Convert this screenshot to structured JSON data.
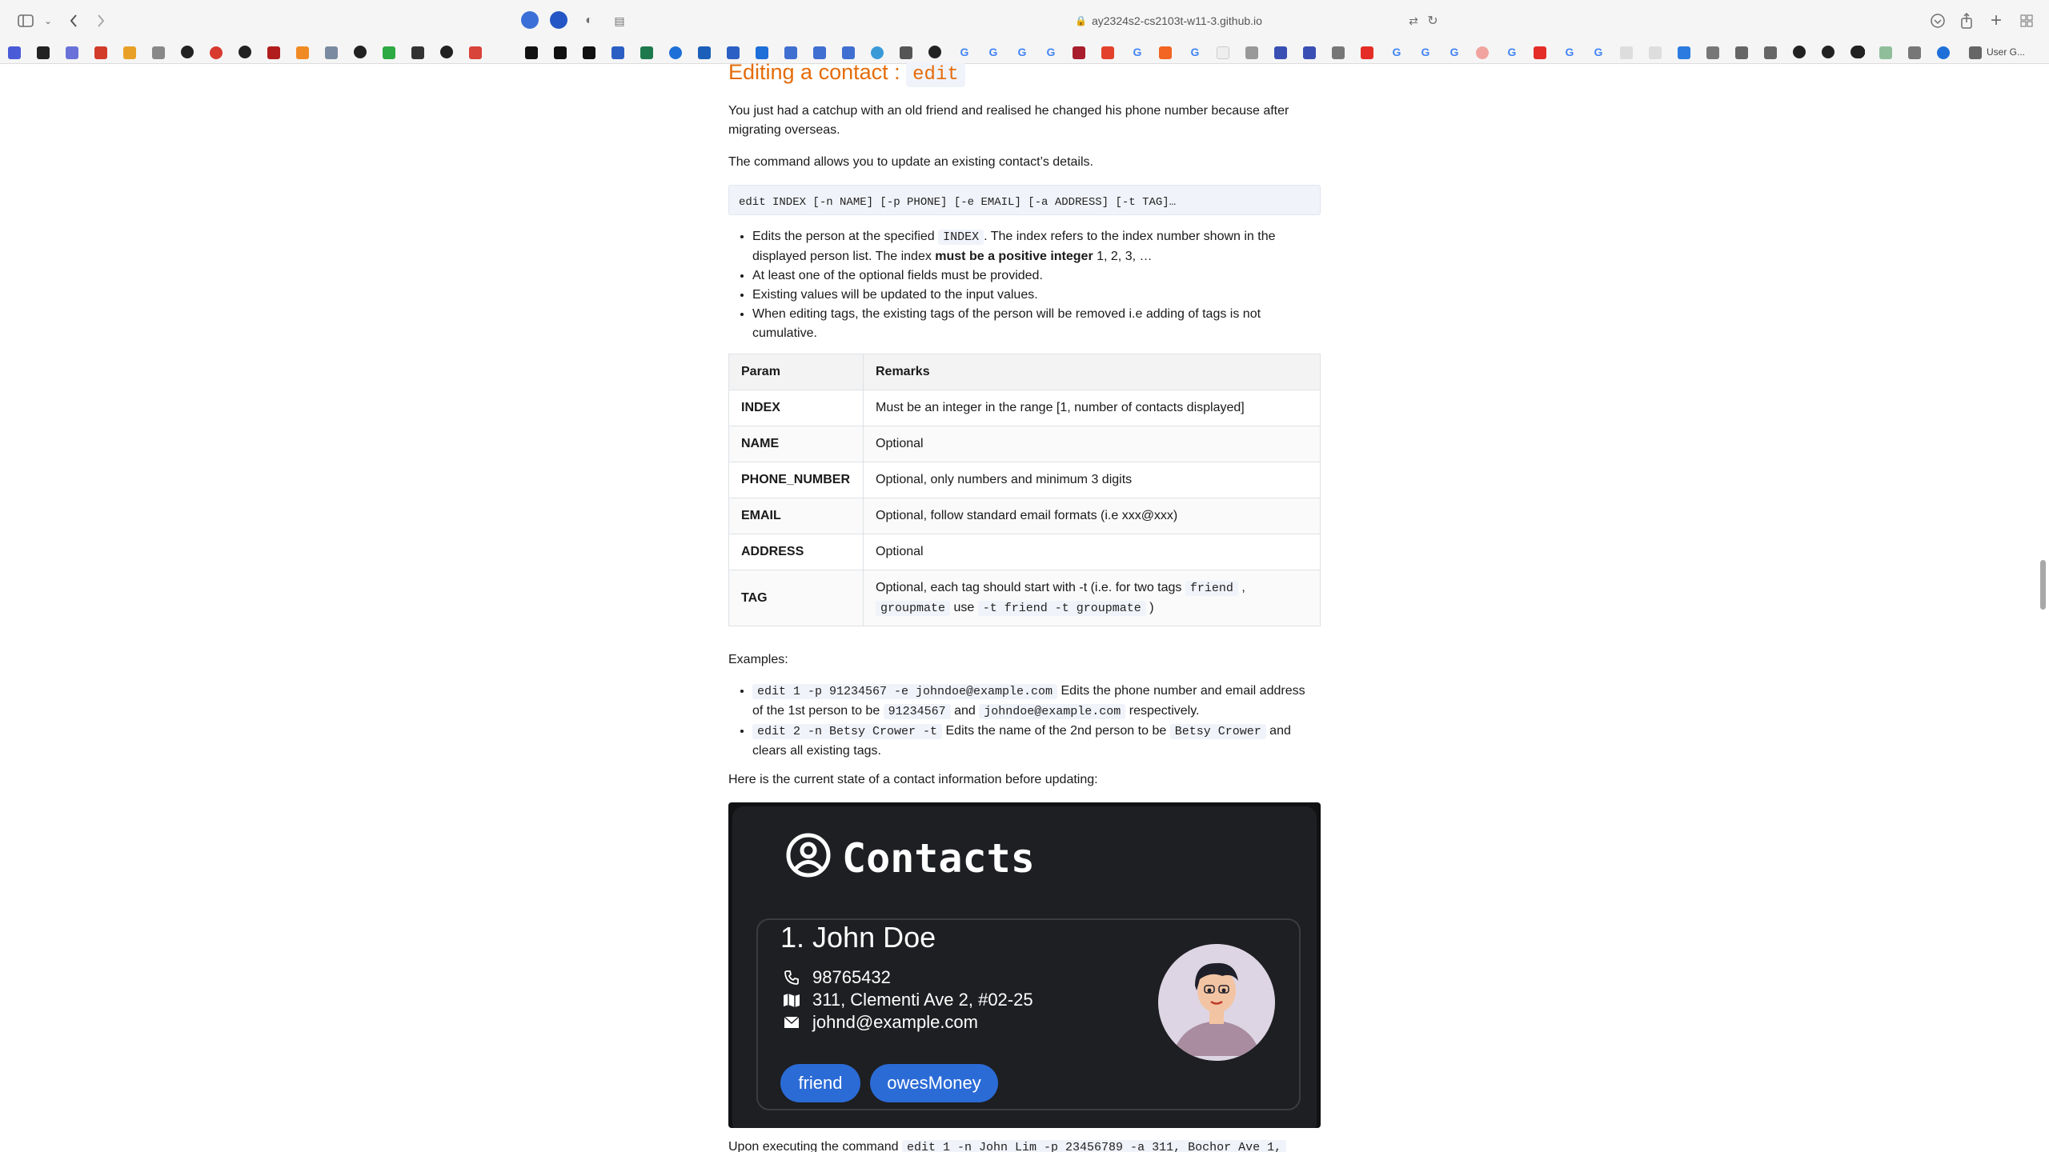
{
  "browser": {
    "url": "ay2324s2-cs2103t-w11-3.github.io",
    "bookmark_last_label": "User G..."
  },
  "section": {
    "title": "Editing a contact : ",
    "command_word": "edit"
  },
  "intro": {
    "p1": "You just had a catchup with an old friend and realised he changed his phone number because after migrating overseas.",
    "p2": "The command allows you to update an existing contact’s details.",
    "format": "edit INDEX [-n NAME] [-p PHONE] [-e EMAIL] [-a ADDRESS] [-t TAG]…"
  },
  "bullets": {
    "b1_pre": "Edits the person at the specified ",
    "b1_code": "INDEX",
    "b1_mid": ". The index refers to the index number shown in the displayed person list. The index ",
    "b1_bold": "must be a positive integer",
    "b1_post": " 1, 2, 3, …",
    "b2": "At least one of the optional fields must be provided.",
    "b3": "Existing values will be updated to the input values.",
    "b4": "When editing tags, the existing tags of the person will be removed i.e adding of tags is not cumulative."
  },
  "table": {
    "head_param": "Param",
    "head_remarks": "Remarks",
    "rows": [
      {
        "param": "INDEX",
        "remark": "Must be an integer in the range [1, number of contacts displayed]"
      },
      {
        "param": "NAME",
        "remark": "Optional"
      },
      {
        "param": "PHONE_NUMBER",
        "remark": "Optional, only numbers and minimum 3 digits"
      },
      {
        "param": "EMAIL",
        "remark": "Optional, follow standard email formats (i.e xxx@xxx)"
      },
      {
        "param": "ADDRESS",
        "remark": "Optional"
      }
    ],
    "tag_row": {
      "param": "TAG",
      "remark_pre": "Optional, each tag should start with -t (i.e. for two tags ",
      "code1": "friend",
      "sep": " ,",
      "code2": "groupmate",
      "use": " use ",
      "code3": "-t friend -t groupmate",
      "post": " )"
    }
  },
  "examples": {
    "label": "Examples:",
    "e1_code": "edit 1 -p 91234567 -e johndoe@example.com",
    "e1_text": " Edits the phone number and email address of the 1st person to be ",
    "e1_code2": "91234567",
    "e1_and": " and ",
    "e1_code3": "johndoe@example.com",
    "e1_end": " respectively.",
    "e2_code": "edit 2 -n Betsy Crower -t",
    "e2_text": " Edits the name of the 2nd person to be ",
    "e2_code2": "Betsy Crower",
    "e2_end": " and clears all existing tags."
  },
  "state_label": "Here is the current state of a contact information before updating:",
  "contacts_app": {
    "title": "Contacts",
    "card": {
      "name": "1. John Doe",
      "phone": "98765432",
      "address": "311, Clementi Ave 2, #02-25",
      "email": "johnd@example.com",
      "tags": [
        "friend",
        "owesMoney"
      ]
    }
  },
  "bottom": {
    "pre": "Upon executing the command ",
    "code": "edit 1 -n John Lim -p 23456789 -a 311, Bochor Ave 1,"
  }
}
